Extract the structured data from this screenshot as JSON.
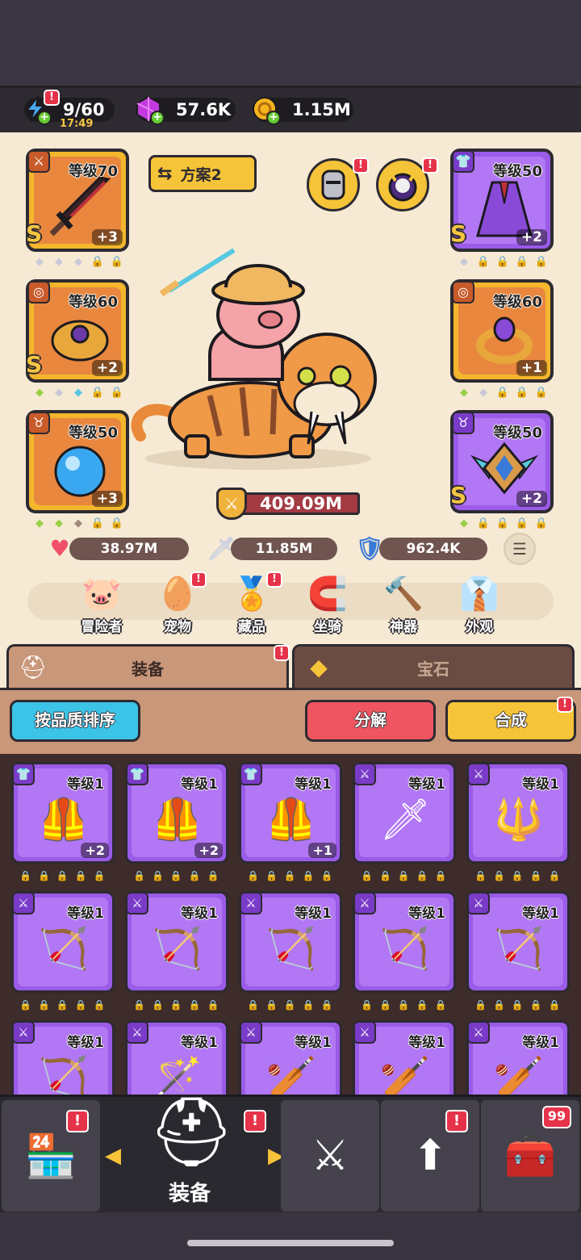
{
  "resources": {
    "energy": "9/60",
    "energy_timer": "17:49",
    "gems": "57.6K",
    "gold": "1.15M"
  },
  "plan_label": "方案2",
  "equip_slots": [
    {
      "level": "等级70",
      "plus": "+3",
      "grade": "S",
      "rarity": "gold",
      "icon": "dark-sword-icon"
    },
    {
      "level": "等级60",
      "plus": "+2",
      "grade": "S",
      "rarity": "gold",
      "icon": "amulet-icon"
    },
    {
      "level": "等级50",
      "plus": "+3",
      "grade": "",
      "rarity": "gold",
      "icon": "blue-orb-icon"
    },
    {
      "level": "等级50",
      "plus": "+2",
      "grade": "S",
      "rarity": "purple",
      "icon": "cloak-icon"
    },
    {
      "level": "等级60",
      "plus": "+1",
      "grade": "",
      "rarity": "gold",
      "icon": "ring-icon"
    },
    {
      "level": "等级50",
      "plus": "+2",
      "grade": "S",
      "rarity": "purple",
      "icon": "winged-emblem-icon"
    }
  ],
  "power": "409.09M",
  "stats": {
    "hp": "38.97M",
    "attack": "11.85M",
    "defense": "962.4K"
  },
  "categories": [
    "冒险者",
    "宠物",
    "藏品",
    "坐骑",
    "神器",
    "外观"
  ],
  "tabs": {
    "equipment": "装备",
    "gems": "宝石"
  },
  "buttons": {
    "sort": "按品质排序",
    "dismantle": "分解",
    "merge": "合成"
  },
  "inventory": [
    {
      "level": "等级1",
      "plus": "+2",
      "type": "armor"
    },
    {
      "level": "等级1",
      "plus": "+2",
      "type": "armor"
    },
    {
      "level": "等级1",
      "plus": "+1",
      "type": "armor"
    },
    {
      "level": "等级1",
      "plus": "",
      "type": "sword"
    },
    {
      "level": "等级1",
      "plus": "",
      "type": "spear"
    },
    {
      "level": "等级1",
      "plus": "",
      "type": "crossbow"
    },
    {
      "level": "等级1",
      "plus": "",
      "type": "crossbow"
    },
    {
      "level": "等级1",
      "plus": "",
      "type": "crossbow"
    },
    {
      "level": "等级1",
      "plus": "",
      "type": "crossbow"
    },
    {
      "level": "等级1",
      "plus": "",
      "type": "crossbow"
    },
    {
      "level": "等级1",
      "plus": "",
      "type": "crossbow"
    },
    {
      "level": "等级1",
      "plus": "",
      "type": "staff"
    },
    {
      "level": "等级1",
      "plus": "",
      "type": "club"
    },
    {
      "level": "等级1",
      "plus": "",
      "type": "club"
    },
    {
      "level": "等级1",
      "plus": "",
      "type": "club"
    }
  ],
  "nav": {
    "active_label": "装备",
    "chest_badge": "99"
  },
  "colors": {
    "gold_rarity": "#f3b62d",
    "purple_rarity": "#9a5ce8",
    "alert_red": "#e63349",
    "sort_button": "#3cc4e8",
    "dismantle_button": "#ee5561",
    "merge_button": "#f6c438"
  }
}
